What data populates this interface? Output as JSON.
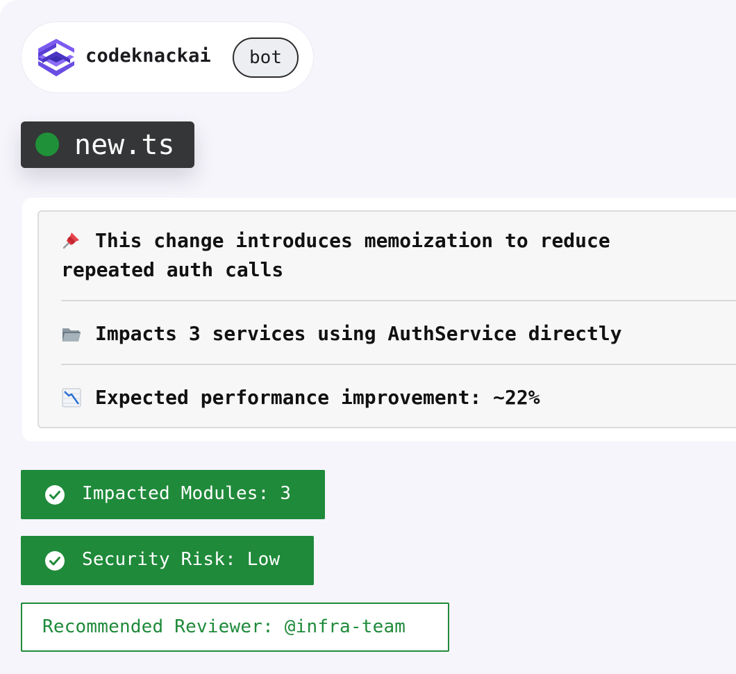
{
  "bot": {
    "name": "codeknackai",
    "badge": "bot",
    "logo_icon": "codeknackai-logo",
    "logo_colors": [
      "#5a3fd6",
      "#7c5cf0",
      "#3a2bb0"
    ]
  },
  "file": {
    "name": "new.ts",
    "status_color": "#1f9239"
  },
  "summary": {
    "items": [
      {
        "icon": "pushpin-icon",
        "text": "This change introduces memoization to reduce",
        "text_line2": "repeated auth calls"
      },
      {
        "icon": "folder-icon",
        "text": "Impacts 3 services using AuthService directly"
      },
      {
        "icon": "chart-decreasing-icon",
        "text": "Expected performance improvement: ~22%"
      }
    ]
  },
  "badges": {
    "impacted_modules": "Impacted Modules: 3",
    "security_risk": "Security Risk: Low",
    "recommended_reviewer": "Recommended Reviewer: @infra-team"
  },
  "colors": {
    "accent_green": "#1f8a3a",
    "background": "#f6f5fb",
    "file_tag_bg": "#353637"
  }
}
